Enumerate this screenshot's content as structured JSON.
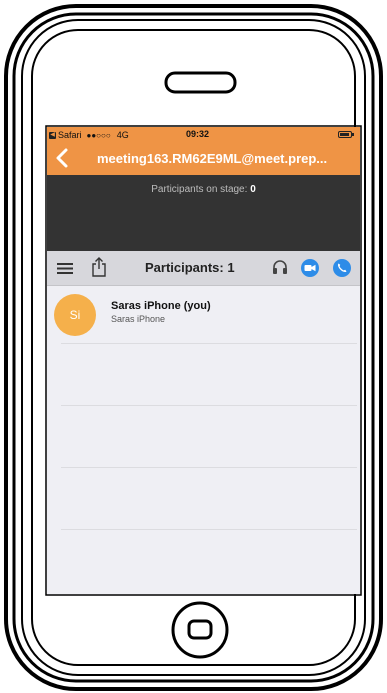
{
  "status_bar": {
    "back_app_label": "Safari",
    "signal": "●●○○○",
    "network": "4G",
    "time": "09:32"
  },
  "nav": {
    "title": "meeting163.RM62E9ML@meet.prep..."
  },
  "stage": {
    "label": "Participants on stage:",
    "count": "0"
  },
  "toolbar": {
    "title": "Participants: 1"
  },
  "participants": [
    {
      "initials": "Si",
      "name": "Saras iPhone (you)",
      "device": "Saras iPhone"
    }
  ],
  "colors": {
    "accent": "#ef9445",
    "avatar": "#f5b04b",
    "stage_bg": "#333333",
    "icon_blue": "#2d8ce8"
  },
  "icons": {
    "menu": "hamburger-icon",
    "share": "share-icon",
    "headset": "headset-icon",
    "video": "video-icon",
    "phone": "phone-icon",
    "back": "chevron-left-icon"
  }
}
